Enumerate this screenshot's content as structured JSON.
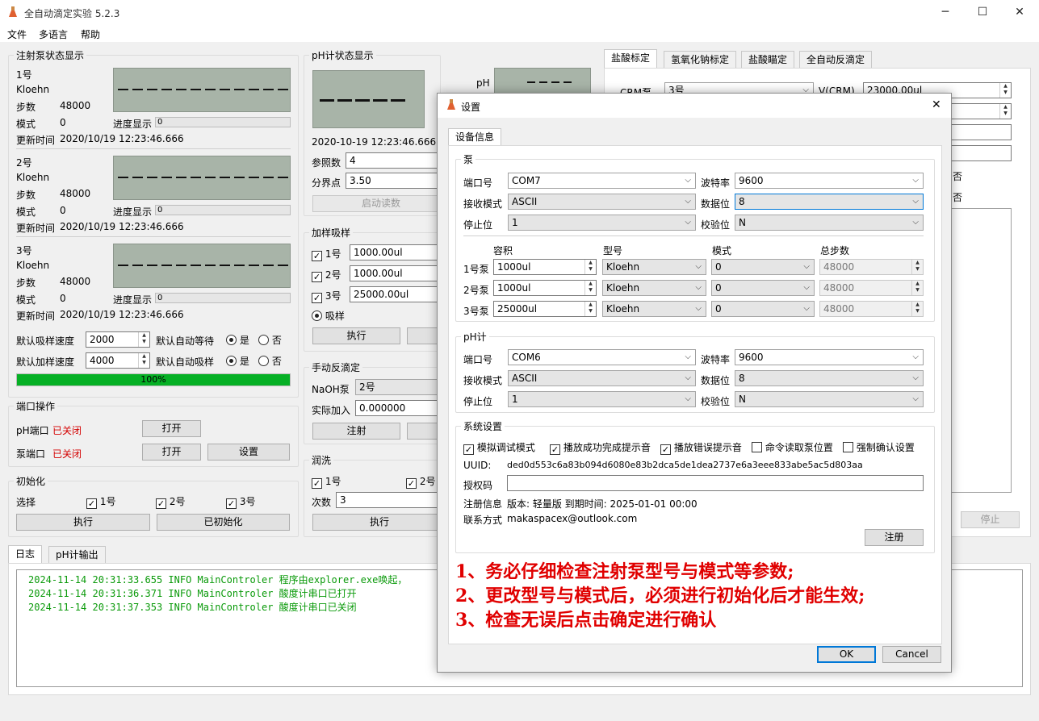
{
  "app": {
    "title": "全自动滴定实验 5.2.3",
    "menu": [
      "文件",
      "多语言",
      "帮助"
    ],
    "min": "─",
    "max": "☐",
    "close": "✕"
  },
  "pump_status": {
    "title": "注射泵状态显示",
    "pumps": [
      {
        "name": "1号",
        "brand": "Kloehn",
        "steps_label": "步数",
        "steps": "48000",
        "mode_label": "模式",
        "mode": "0",
        "progress_label": "进度显示",
        "progress": "0",
        "time_label": "更新时间",
        "time": "2020/10/19 12:23:46.666"
      },
      {
        "name": "2号",
        "brand": "Kloehn",
        "steps_label": "步数",
        "steps": "48000",
        "mode_label": "模式",
        "mode": "0",
        "progress_label": "进度显示",
        "progress": "0",
        "time_label": "更新时间",
        "time": "2020/10/19 12:23:46.666"
      },
      {
        "name": "3号",
        "brand": "Kloehn",
        "steps_label": "步数",
        "steps": "48000",
        "mode_label": "模式",
        "mode": "0",
        "progress_label": "进度显示",
        "progress": "0",
        "time_label": "更新时间",
        "time": "2020/10/19 12:23:46.666"
      }
    ]
  },
  "defaults": {
    "suck_speed_label": "默认吸样速度",
    "suck_speed": "2000",
    "auto_wait_label": "默认自动等待",
    "add_speed_label": "默认加样速度",
    "add_speed": "4000",
    "auto_suck_label": "默认自动吸样",
    "yes": "是",
    "no": "否",
    "progress_text": "100%",
    "progress_value": 1.0
  },
  "port": {
    "title": "端口操作",
    "ph_label": "pH端口",
    "ph_state": "已关闭",
    "pump_label": "泵端口",
    "pump_state": "已关闭",
    "open": "打开",
    "settings": "设置"
  },
  "init": {
    "title": "初始化",
    "select_label": "选择",
    "p1": "1号",
    "p2": "2号",
    "p3": "3号",
    "exec": "执行",
    "inited": "已初始化"
  },
  "ph_status": {
    "title": "pH计状态显示",
    "ph_label": "pH",
    "time": "2020-10-19 12:23:46.666",
    "ref_label": "参照数",
    "ref": "4",
    "split_label": "分界点",
    "split": "3.50",
    "start_read": "启动读数"
  },
  "add_suck": {
    "title": "加样吸样",
    "p1": "1号",
    "v1": "1000.00ul",
    "p2": "2号",
    "v2": "1000.00ul",
    "p3": "3号",
    "v3": "25000.00ul",
    "suck": "吸样",
    "exec": "执行"
  },
  "manual": {
    "title": "手动反滴定",
    "naoh_label": "NaOH泵",
    "naoh": "2号",
    "actual_label": "实际加入",
    "actual": "0.000000",
    "inject": "注射"
  },
  "rinse": {
    "title": "润洗",
    "p1": "1号",
    "p2": "2号",
    "times_label": "次数",
    "times": "3",
    "exec": "执行"
  },
  "right_tabs": [
    "盐酸标定",
    "氢氧化钠标定",
    "盐酸瞄定",
    "全自动反滴定"
  ],
  "right": {
    "crm_label": "CRM泵",
    "crm": "3号",
    "vcrm_label": "V(CRM)",
    "vcrm": "23000.00ul",
    "no1": "否",
    "no2": "否",
    "stop": "停止"
  },
  "log_tabs": [
    "日志",
    "pH计输出"
  ],
  "log": [
    "2024-11-14 20:31:33.655 INFO MainControler 程序由explorer.exe唤起，",
    "2024-11-14 20:31:36.371 INFO MainControler 酸度计串口已打开",
    "2024-11-14 20:31:37.353 INFO MainControler 酸度计串口已关闭"
  ],
  "dialog": {
    "title": "设置",
    "close": "✕",
    "tab": "设备信息",
    "pump": {
      "title": "泵",
      "port_label": "端口号",
      "port": "COM7",
      "baud_label": "波特率",
      "baud": "9600",
      "recv_label": "接收模式",
      "recv": "ASCII",
      "data_label": "数据位",
      "data": "8",
      "stop_label": "停止位",
      "stop": "1",
      "parity_label": "校验位",
      "parity": "N",
      "cols": [
        "容积",
        "型号",
        "模式",
        "总步数"
      ],
      "rows": [
        {
          "name": "1号泵",
          "vol": "1000ul",
          "model": "Kloehn",
          "mode": "0",
          "steps": "48000"
        },
        {
          "name": "2号泵",
          "vol": "1000ul",
          "model": "Kloehn",
          "mode": "0",
          "steps": "48000"
        },
        {
          "name": "3号泵",
          "vol": "25000ul",
          "model": "Kloehn",
          "mode": "0",
          "steps": "48000"
        }
      ]
    },
    "ph": {
      "title": "pH计",
      "port_label": "端口号",
      "port": "COM6",
      "baud_label": "波特率",
      "baud": "9600",
      "recv_label": "接收模式",
      "recv": "ASCII",
      "data_label": "数据位",
      "data": "8",
      "stop_label": "停止位",
      "stop": "1",
      "parity_label": "校验位",
      "parity": "N"
    },
    "sys": {
      "title": "系统设置",
      "c1": "模拟调试模式",
      "c2": "播放成功完成提示音",
      "c3": "播放错误提示音",
      "c4": "命令读取泵位置",
      "c5": "强制确认设置",
      "uuid_label": "UUID:",
      "uuid": "ded0d553c6a83b094d6080e83b2dca5de1dea2737e6a3eee833abe5ac5d803aa",
      "code_label": "授权码",
      "reg_label": "注册信息",
      "reg": "版本: 轻量版 到期时间: 2025-01-01 00:00",
      "contact_label": "联系方式",
      "contact": "makaspacex@outlook.com",
      "register": "注册"
    },
    "warnings": [
      "1、务必仔细检查注射泵型号与模式等参数;",
      "2、更改型号与模式后，必须进行初始化后才能生效;",
      "3、检查无误后点击确定进行确认"
    ],
    "ok": "OK",
    "cancel": "Cancel"
  }
}
